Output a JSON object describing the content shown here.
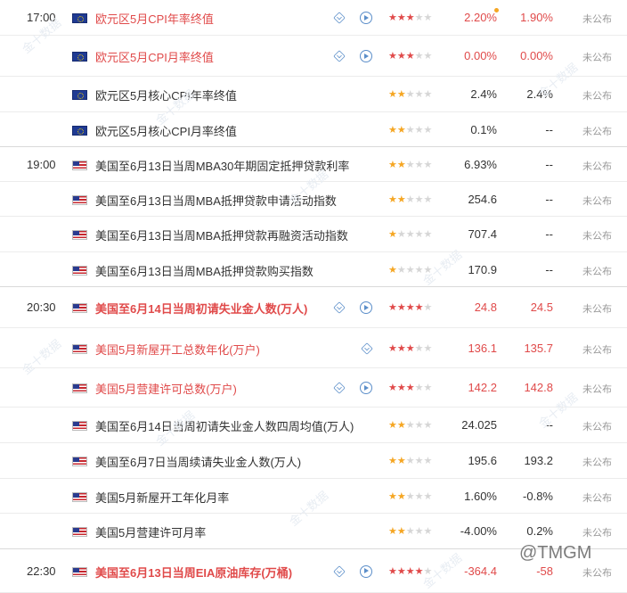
{
  "rows": [
    {
      "time": "17:00",
      "flag": "eu",
      "name": "欧元区5月CPI年率终值",
      "hl": true,
      "bold": false,
      "cube": true,
      "play": true,
      "stars": 3,
      "star_color": "red",
      "prev": "2.20%",
      "prev_hl": true,
      "dot": true,
      "fc": "1.90%",
      "fc_hl": true,
      "pub": "未公布"
    },
    {
      "time": "",
      "flag": "eu",
      "name": "欧元区5月CPI月率终值",
      "hl": true,
      "bold": false,
      "cube": true,
      "play": true,
      "stars": 3,
      "star_color": "red",
      "prev": "0.00%",
      "prev_hl": true,
      "fc": "0.00%",
      "fc_hl": true,
      "pub": "未公布"
    },
    {
      "time": "",
      "flag": "eu",
      "name": "欧元区5月核心CPI年率终值",
      "hl": false,
      "bold": false,
      "stars": 2,
      "star_color": "yel",
      "prev": "2.4%",
      "fc": "2.4%",
      "pub": "未公布"
    },
    {
      "time": "",
      "flag": "eu",
      "name": "欧元区5月核心CPI月率终值",
      "hl": false,
      "bold": false,
      "stars": 2,
      "star_color": "yel",
      "prev": "0.1%",
      "fc": "--",
      "pub": "未公布",
      "group_end": true
    },
    {
      "time": "19:00",
      "flag": "us",
      "name": "美国至6月13日当周MBA30年期固定抵押贷款利率",
      "hl": false,
      "bold": false,
      "stars": 2,
      "star_color": "yel",
      "prev": "6.93%",
      "fc": "--",
      "pub": "未公布"
    },
    {
      "time": "",
      "flag": "us",
      "name": "美国至6月13日当周MBA抵押贷款申请活动指数",
      "hl": false,
      "bold": false,
      "stars": 2,
      "star_color": "yel",
      "prev": "254.6",
      "fc": "--",
      "pub": "未公布"
    },
    {
      "time": "",
      "flag": "us",
      "name": "美国至6月13日当周MBA抵押贷款再融资活动指数",
      "hl": false,
      "bold": false,
      "stars": 1,
      "star_color": "yel",
      "prev": "707.4",
      "fc": "--",
      "pub": "未公布"
    },
    {
      "time": "",
      "flag": "us",
      "name": "美国至6月13日当周MBA抵押贷款购买指数",
      "hl": false,
      "bold": false,
      "stars": 1,
      "star_color": "yel",
      "prev": "170.9",
      "fc": "--",
      "pub": "未公布",
      "group_end": true
    },
    {
      "time": "20:30",
      "flag": "us",
      "name": "美国至6月14日当周初请失业金人数(万人)",
      "hl": true,
      "bold": true,
      "cube": true,
      "play": true,
      "stars": 4,
      "star_color": "red",
      "prev": "24.8",
      "prev_hl": true,
      "fc": "24.5",
      "fc_hl": true,
      "pub": "未公布"
    },
    {
      "time": "",
      "flag": "us",
      "name": "美国5月新屋开工总数年化(万户)",
      "hl": true,
      "bold": false,
      "cube": true,
      "cube_only": true,
      "stars": 3,
      "star_color": "red",
      "prev": "136.1",
      "prev_hl": true,
      "fc": "135.7",
      "fc_hl": true,
      "pub": "未公布"
    },
    {
      "time": "",
      "flag": "us",
      "name": "美国5月营建许可总数(万户)",
      "hl": true,
      "bold": false,
      "cube": true,
      "play": true,
      "stars": 3,
      "star_color": "red",
      "prev": "142.2",
      "prev_hl": true,
      "fc": "142.8",
      "fc_hl": true,
      "pub": "未公布"
    },
    {
      "time": "",
      "flag": "us",
      "name": "美国至6月14日当周初请失业金人数四周均值(万人)",
      "hl": false,
      "bold": false,
      "stars": 2,
      "star_color": "yel",
      "prev": "24.025",
      "fc": "--",
      "pub": "未公布"
    },
    {
      "time": "",
      "flag": "us",
      "name": "美国至6月7日当周续请失业金人数(万人)",
      "hl": false,
      "bold": false,
      "stars": 2,
      "star_color": "yel",
      "prev": "195.6",
      "fc": "193.2",
      "pub": "未公布"
    },
    {
      "time": "",
      "flag": "us",
      "name": "美国5月新屋开工年化月率",
      "hl": false,
      "bold": false,
      "stars": 2,
      "star_color": "yel",
      "prev": "1.60%",
      "fc": "-0.8%",
      "pub": "未公布"
    },
    {
      "time": "",
      "flag": "us",
      "name": "美国5月营建许可月率",
      "hl": false,
      "bold": false,
      "stars": 2,
      "star_color": "yel",
      "prev": "-4.00%",
      "fc": "0.2%",
      "pub": "未公布",
      "group_end": true
    },
    {
      "time": "22:30",
      "flag": "us",
      "name": "美国至6月13日当周EIA原油库存(万桶)",
      "hl": true,
      "bold": true,
      "cube": true,
      "play": true,
      "stars": 4,
      "star_color": "red",
      "prev": "-364.4",
      "prev_hl": true,
      "fc": "-58",
      "fc_hl": true,
      "pub": "未公布"
    }
  ],
  "watermark": "@TMGM",
  "watermark_bg": "金十数据"
}
